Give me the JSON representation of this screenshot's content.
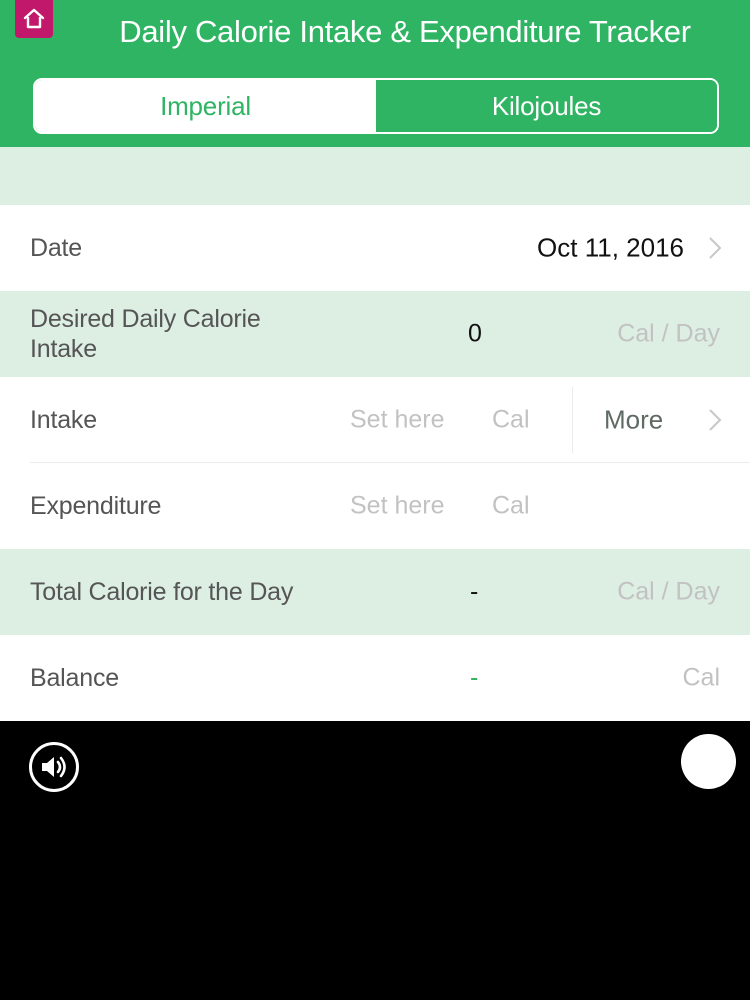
{
  "header": {
    "title": "Daily Calorie Intake & Expenditure Tracker",
    "tabs": [
      {
        "label": "Imperial",
        "selected": true
      },
      {
        "label": "Kilojoules",
        "selected": false
      }
    ],
    "home_icon": "home-icon"
  },
  "rows": {
    "date": {
      "label": "Date",
      "value": "Oct 11, 2016"
    },
    "desired": {
      "label_line1": "Desired Daily Calorie",
      "label_line2": "Intake",
      "value": "0",
      "unit": "Cal / Day"
    },
    "intake": {
      "label": "Intake",
      "placeholder": "Set here",
      "unit": "Cal",
      "more_label": "More"
    },
    "expenditure": {
      "label": "Expenditure",
      "placeholder": "Set here",
      "unit": "Cal"
    },
    "total": {
      "label": "Total Calorie for the Day",
      "value": "-",
      "unit": "Cal / Day"
    },
    "balance": {
      "label": "Balance",
      "value": "-",
      "unit": "Cal"
    }
  },
  "toolbar": {
    "sound_icon": "speaker-icon",
    "circle_icon": "white-circle-button"
  },
  "colors": {
    "accent": "#2fb463",
    "home_button": "#c2186b",
    "row_tint": "#ddeee3",
    "balance_value": "#2fb463"
  }
}
